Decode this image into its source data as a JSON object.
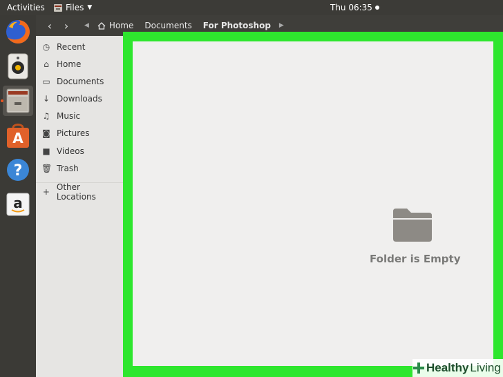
{
  "topbar": {
    "activities": "Activities",
    "app_menu": "Files",
    "clock": "Thu 06:35"
  },
  "dock": {
    "items": [
      "firefox-icon",
      "rhythmbox-icon",
      "files-icon",
      "software-center-icon",
      "help-icon",
      "amazon-icon"
    ],
    "running_color": "#e95420"
  },
  "header": {
    "breadcrumbs": [
      "Home",
      "Documents",
      "For Photoshop"
    ]
  },
  "sidebar": {
    "items": [
      {
        "label": "Recent",
        "icon": "clock-icon"
      },
      {
        "label": "Home",
        "icon": "home-icon"
      },
      {
        "label": "Documents",
        "icon": "document-icon"
      },
      {
        "label": "Downloads",
        "icon": "download-icon"
      },
      {
        "label": "Music",
        "icon": "music-icon"
      },
      {
        "label": "Pictures",
        "icon": "camera-icon"
      },
      {
        "label": "Videos",
        "icon": "video-icon"
      },
      {
        "label": "Trash",
        "icon": "trash-icon"
      }
    ],
    "other_locations": "Other Locations"
  },
  "main": {
    "empty_text": "Folder is Empty",
    "highlight_color": "#2ee62e"
  },
  "watermark": {
    "brand_bold": "Healthy",
    "brand_light": "Living"
  }
}
